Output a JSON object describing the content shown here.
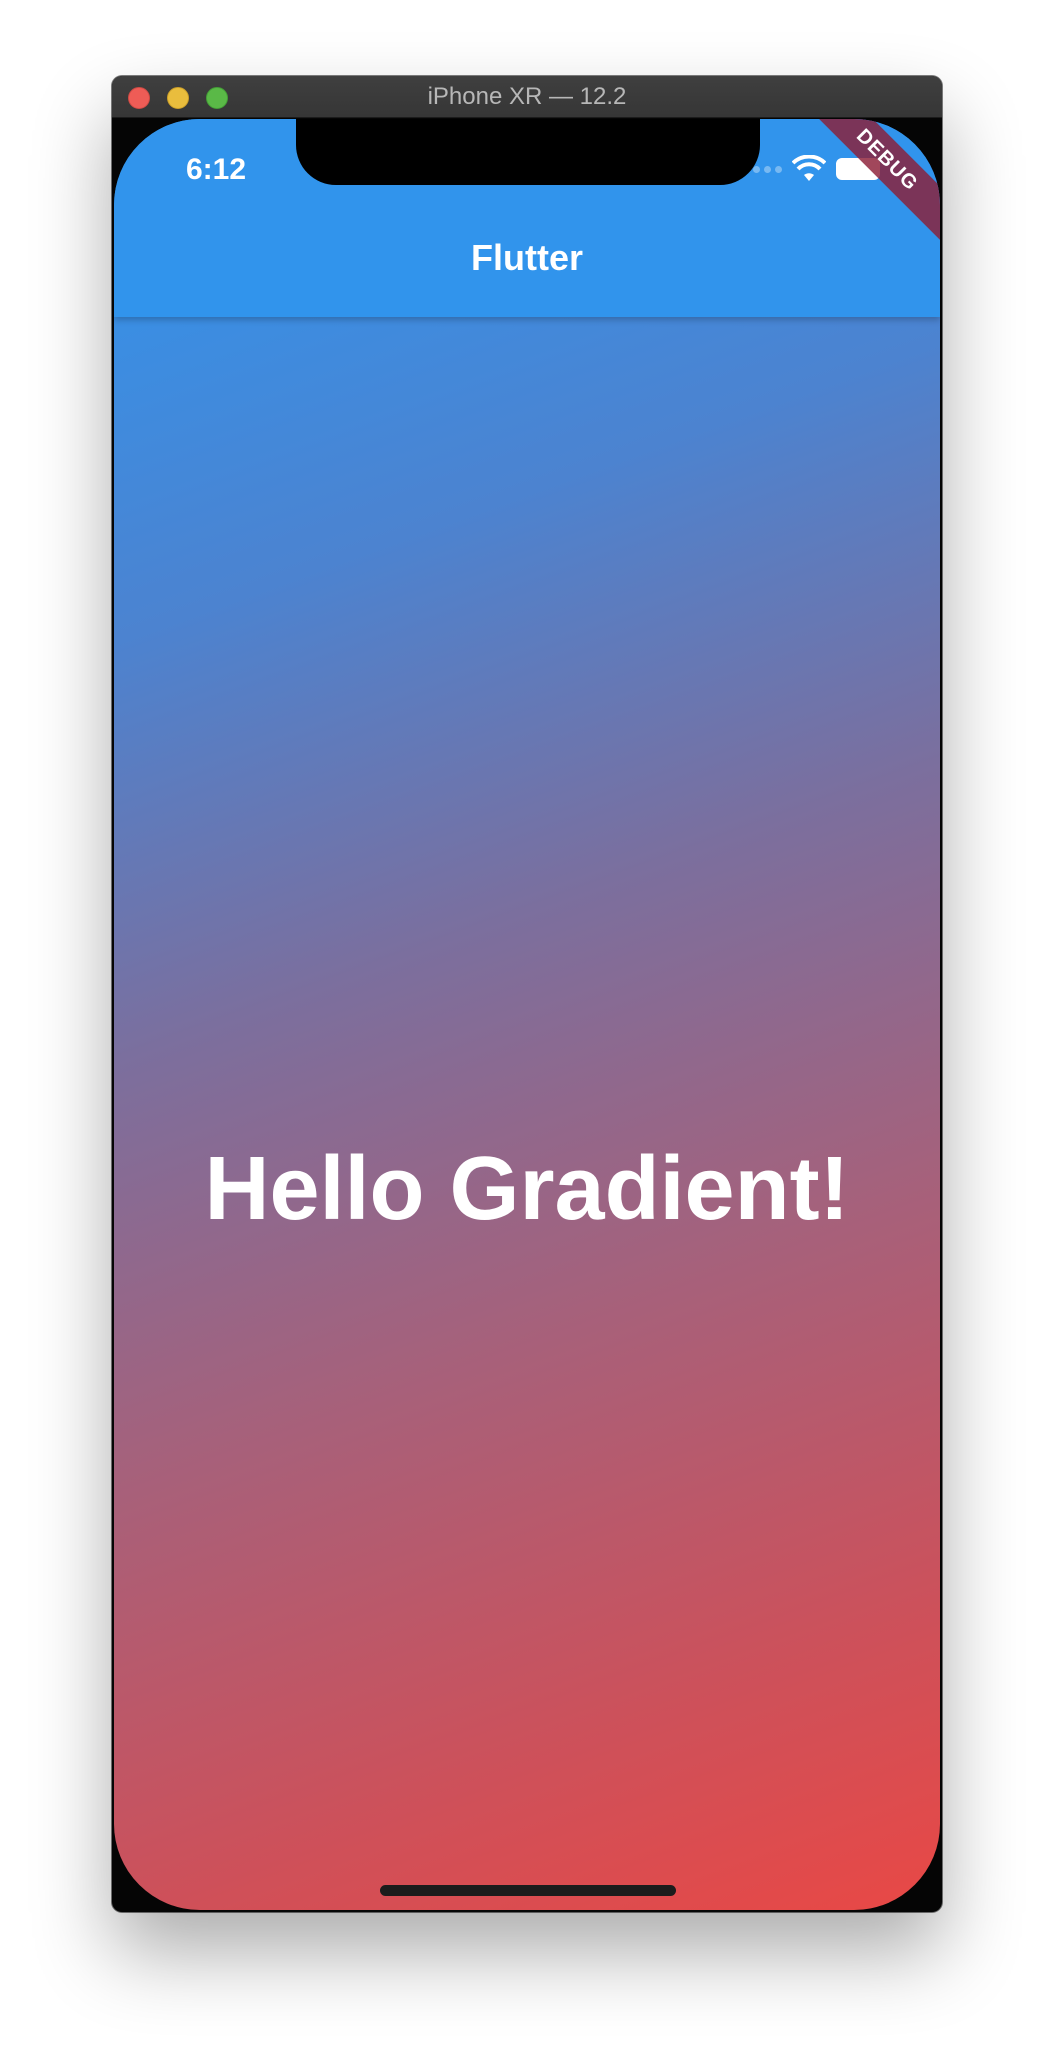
{
  "window": {
    "title": "iPhone XR — 12.2"
  },
  "status_bar": {
    "time": "6:12",
    "icons": [
      "cellular-signal-icon",
      "wifi-icon",
      "battery-icon"
    ]
  },
  "app_bar": {
    "title": "Flutter"
  },
  "debug_banner": {
    "label": "DEBUG"
  },
  "body": {
    "text": "Hello Gradient!"
  },
  "colors": {
    "app_bar": "#3194ec",
    "gradient_top": "#2f95ef",
    "gradient_bottom": "#e94845",
    "text": "#ffffff",
    "debug_banner": "#8c1e37"
  }
}
